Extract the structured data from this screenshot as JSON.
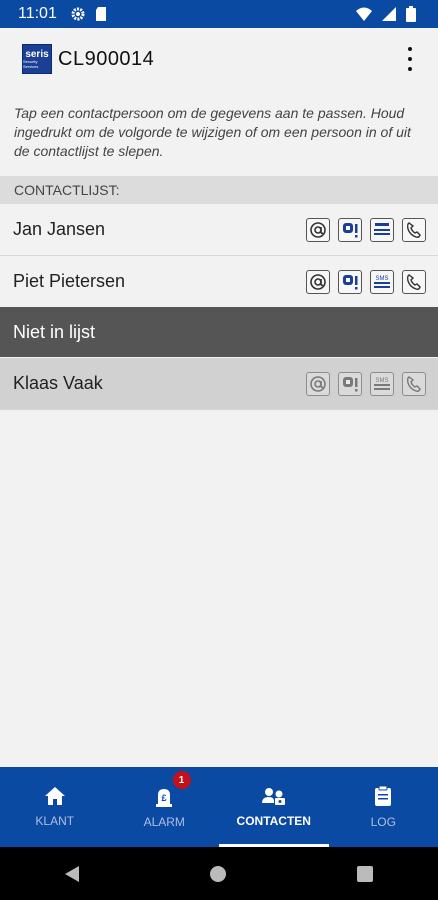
{
  "status": {
    "time": "11:01"
  },
  "app": {
    "title": "CL900014",
    "logo_text": "seris",
    "logo_sub": "Security Services"
  },
  "hint": "Tap een contactpersoon om de gegevens aan te passen. Houd ingedrukt om de volgorde te wijzigen of om een persoon in of uit de contactlijst te slepen.",
  "section": {
    "label": "CONTACTLIJST:"
  },
  "contacts": [
    {
      "name": "Jan Jansen"
    },
    {
      "name": "Piet Pietersen"
    }
  ],
  "niet_in_lijst": {
    "label": "Niet in lijst"
  },
  "inactive": [
    {
      "name": "Klaas Vaak"
    }
  ],
  "icons": {
    "email": "email-icon",
    "pager": "pager-icon",
    "sms": "sms-icon",
    "phone": "phone-icon"
  },
  "sms_label": "SMS",
  "nav": {
    "tabs": [
      {
        "label": "KLANT",
        "icon": "home-icon"
      },
      {
        "label": "ALARM",
        "icon": "alarm-icon",
        "badge": "1"
      },
      {
        "label": "CONTACTEN",
        "icon": "contacts-icon"
      },
      {
        "label": "LOG",
        "icon": "clipboard-icon"
      }
    ]
  },
  "colors": {
    "primary": "#0b4aa3",
    "badge": "#c4101a",
    "divider_row": "#555555"
  }
}
